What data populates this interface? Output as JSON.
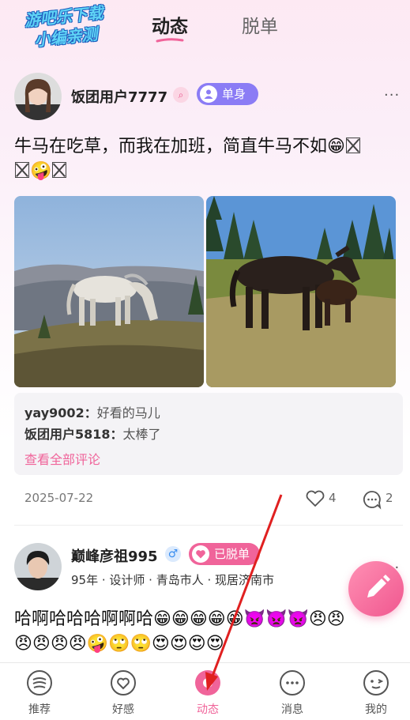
{
  "watermark": {
    "line1": "游吧乐下载",
    "line2": "小编亲测"
  },
  "top_tabs": [
    {
      "label": "动态",
      "active": true
    },
    {
      "label": "脱单",
      "active": false
    }
  ],
  "posts": [
    {
      "username": "饭团用户7777",
      "search_badge_icon": "search-icon",
      "relationship_badge": {
        "label": "单身",
        "icon": "person-icon",
        "color": "#8b7cf5"
      },
      "more": "···",
      "content_text_line1": "牛马在吃草，而我在加班，简直牛马不如",
      "content_emojis_line1": "😁",
      "content_emojis_line2": "🤪",
      "photos": [
        {
          "subject": "white horse grazing on hillside"
        },
        {
          "subject": "dark horses standing among pine trees"
        }
      ],
      "comments": [
        {
          "user": "yay9002：",
          "text": "好看的马儿"
        },
        {
          "user": "饭团用户5818：",
          "text": "太棒了"
        }
      ],
      "view_all_comments": "查看全部评论",
      "date": "2025-07-22",
      "likes": "4",
      "comment_count": "2"
    },
    {
      "username": "巅峰彦祖995",
      "gender_icon": "male-icon",
      "gender_symbol": "♂",
      "relationship_badge": {
        "label": "已脱单",
        "icon": "heart-icon",
        "color": "#f0649a"
      },
      "more": "···",
      "info": "95年 · 设计师 · 青岛市人 · 现居济南市",
      "content_line1": "哈啊哈哈哈啊啊哈😁😁😁😁😁👿👿👿😠😠",
      "content_line2": "😠😠😠😠🤪🙄🙄😍😍😍😍"
    }
  ],
  "fab_icon": "pencil-icon",
  "bottom_nav": [
    {
      "label": "推荐",
      "icon": "recommend-icon",
      "active": false
    },
    {
      "label": "好感",
      "icon": "heart-icon",
      "active": false
    },
    {
      "label": "动态",
      "icon": "moments-icon",
      "active": true
    },
    {
      "label": "消息",
      "icon": "message-icon",
      "active": false
    },
    {
      "label": "我的",
      "icon": "profile-icon",
      "active": false
    }
  ],
  "colors": {
    "accent": "#f0649a",
    "single_badge": "#8b7cf5",
    "annotation_arrow": "#e02020"
  }
}
